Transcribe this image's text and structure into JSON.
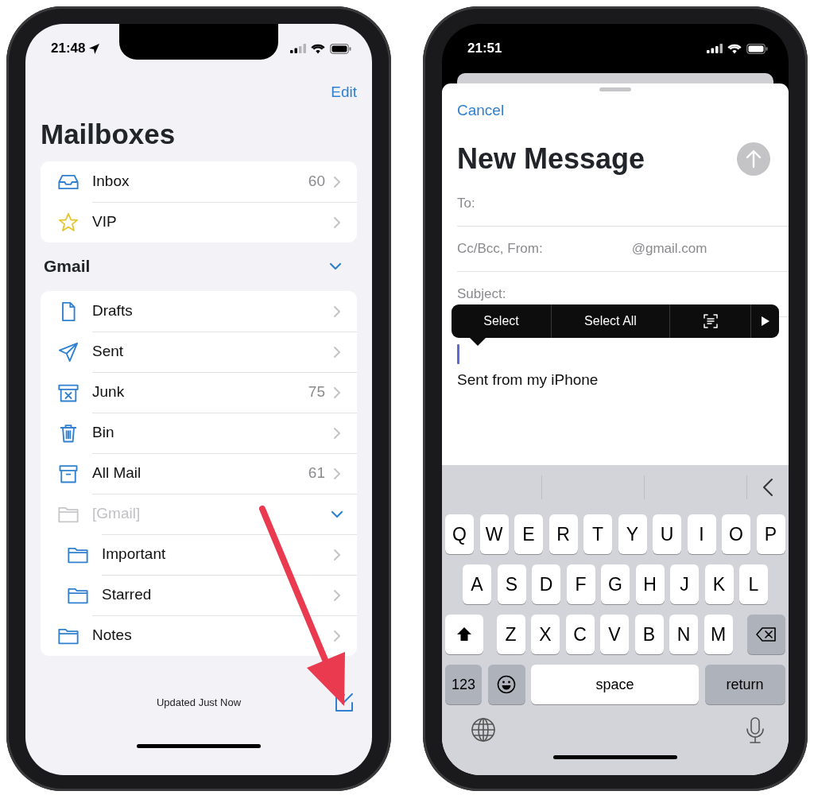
{
  "mailboxes_screen": {
    "status_bar": {
      "time": "21:48",
      "location": true
    },
    "edit_button": "Edit",
    "title": "Mailboxes",
    "favorites": [
      {
        "kind": "inbox",
        "label": "Inbox",
        "count": "60"
      },
      {
        "kind": "star",
        "label": "VIP"
      }
    ],
    "account": {
      "label": "Gmail",
      "expanded": true
    },
    "mailboxes": [
      {
        "kind": "drafts",
        "label": "Drafts",
        "disabled": false
      },
      {
        "kind": "sent",
        "label": "Sent",
        "disabled": false
      },
      {
        "kind": "junk",
        "label": "Junk",
        "count": "75",
        "disabled": false
      },
      {
        "kind": "bin",
        "label": "Bin",
        "disabled": false
      },
      {
        "kind": "archive",
        "label": "All Mail",
        "count": "61",
        "disabled": false
      },
      {
        "kind": "folder",
        "label": "[Gmail]",
        "disabled": true,
        "expanded": true,
        "children": [
          {
            "kind": "folder",
            "label": "Important",
            "disabled": false
          },
          {
            "kind": "folder",
            "label": "Starred",
            "disabled": false
          }
        ]
      },
      {
        "kind": "folder",
        "label": "Notes",
        "disabled": false
      }
    ],
    "toolbar": {
      "status": "Updated Just Now"
    }
  },
  "compose_screen": {
    "status_bar": {
      "time": "21:51"
    },
    "cancel_button": "Cancel",
    "title": "New Message",
    "send_button": {
      "disabled": true
    },
    "fields": [
      {
        "label": "To:"
      },
      {
        "label": "Cc/Bcc, From:",
        "value": "@gmail.com"
      },
      {
        "label": "Subject:"
      }
    ],
    "edit_menu": [
      {
        "kind": "text",
        "label": "Select"
      },
      {
        "kind": "text",
        "label": "Select All"
      },
      {
        "kind": "scan"
      },
      {
        "kind": "more"
      }
    ],
    "body": "Sent from my iPhone",
    "keyboard": {
      "rows": [
        [
          "Q",
          "W",
          "E",
          "R",
          "T",
          "Y",
          "U",
          "I",
          "O",
          "P"
        ],
        [
          "A",
          "S",
          "D",
          "F",
          "G",
          "H",
          "J",
          "K",
          "L"
        ],
        [
          "Z",
          "X",
          "C",
          "V",
          "B",
          "N",
          "M"
        ]
      ],
      "numbers_key": "123",
      "space_key": "space",
      "return_key": "return"
    }
  }
}
